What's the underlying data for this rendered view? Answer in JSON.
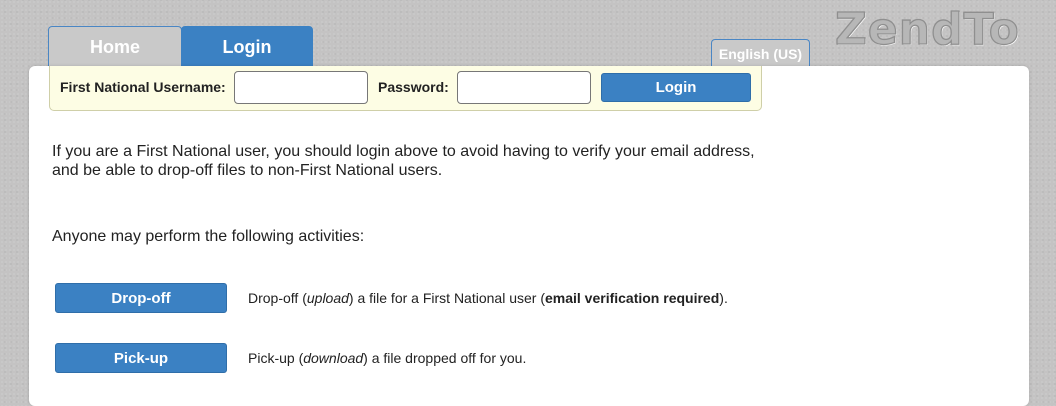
{
  "header": {
    "logo_text": "ZendTo",
    "language_label": "English (US)",
    "tabs": [
      {
        "label": "Home",
        "active": false
      },
      {
        "label": "Login",
        "active": true
      }
    ]
  },
  "login_bar": {
    "username_label": "First National Username:",
    "username_value": "",
    "password_label": "Password:",
    "password_value": "",
    "login_button": "Login"
  },
  "main": {
    "intro_line1": "If you are a First National user, you should login above to avoid having to verify your email address,",
    "intro_line2": "and be able to drop-off files to non-First National users.",
    "anyone_text": "Anyone may perform the following activities:",
    "activities": [
      {
        "button": "Drop-off",
        "desc_pre": "Drop-off (",
        "desc_em": "upload",
        "desc_mid": ") a file for a First National user (",
        "desc_strong": "email verification required",
        "desc_post": ")."
      },
      {
        "button": "Pick-up",
        "desc_pre": "Pick-up (",
        "desc_em": "download",
        "desc_mid": ") a file dropped off for you."
      }
    ]
  },
  "colors": {
    "accent": "#3b81c3",
    "page_background": "#c4c3c3",
    "login_bar_background": "#fdfde4"
  }
}
